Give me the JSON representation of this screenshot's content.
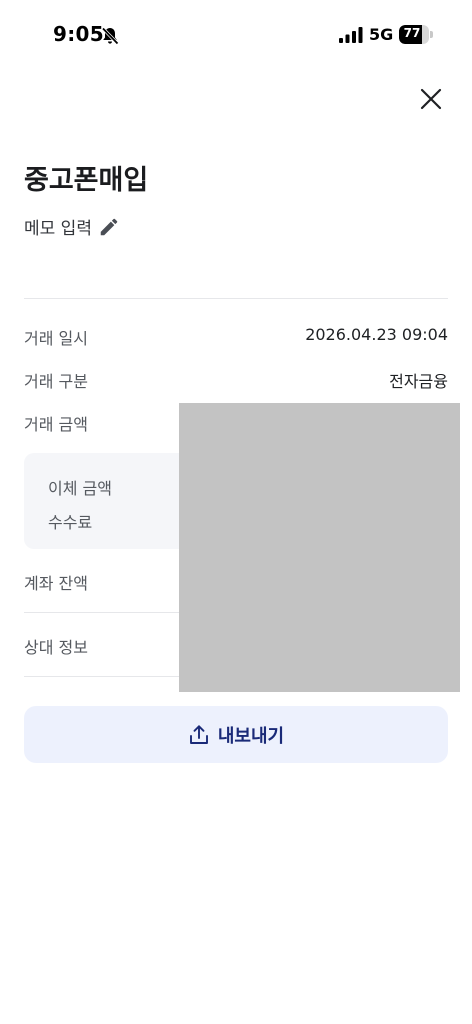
{
  "status_bar": {
    "time": "9:05",
    "network": "5G",
    "battery_level": 77,
    "battery_text": "77"
  },
  "header": {
    "close_icon": "close-icon"
  },
  "title": "중고폰매입",
  "memo": {
    "label": "메모 입력",
    "icon": "pencil-icon"
  },
  "details": {
    "datetime_label": "거래 일시",
    "datetime_value": "2026.04.23 09:04",
    "type_label": "거래 구분",
    "type_value": "전자금융",
    "amount_label": "거래 금액",
    "transfer_amount_label": "이체 금액",
    "fee_label": "수수료",
    "balance_label": "계좌 잔액",
    "counterparty_label": "상대 정보"
  },
  "export_button": {
    "label": "내보내기",
    "icon": "share-icon"
  },
  "colors": {
    "accent": "#1a2a78",
    "button_bg": "#edf1fd",
    "box_bg": "#f5f6f9",
    "redaction": "#c3c3c3"
  }
}
